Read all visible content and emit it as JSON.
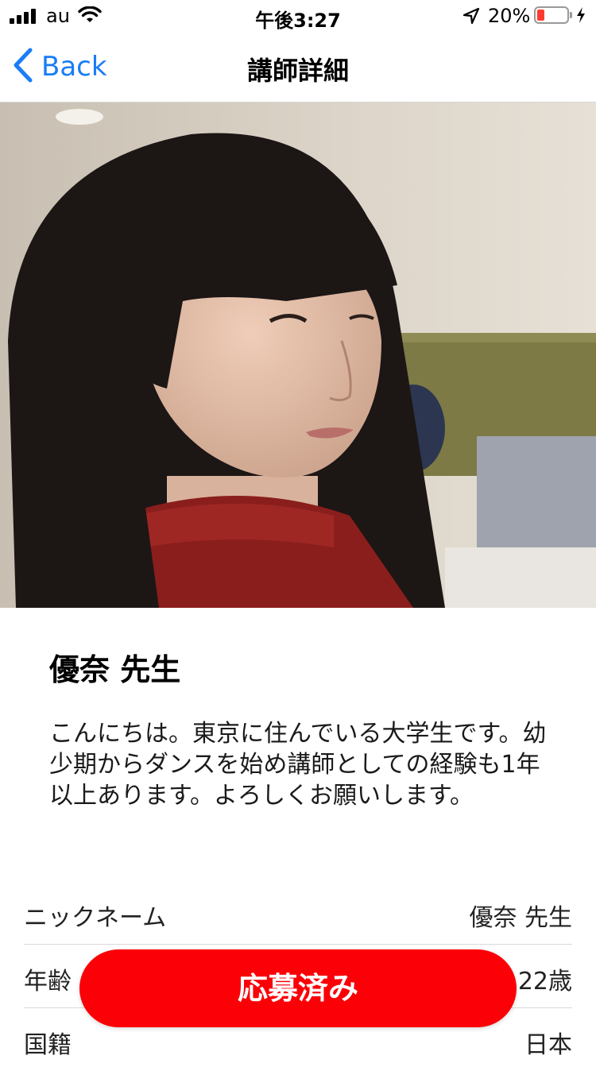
{
  "status_bar": {
    "carrier": "au",
    "time": "午後3:27",
    "battery_percent": "20%",
    "battery_level": 0.2,
    "battery_color": "#ff3b30"
  },
  "nav": {
    "back_label": "Back",
    "title": "講師詳細",
    "accent_color": "#1a7df5"
  },
  "teacher": {
    "photo_icon": "teacher-portrait-photo",
    "name": "優奈 先生",
    "bio": "こんにちは。東京に住んでいる大学生です。幼少期からダンスを始め講師としての経験も1年以上あります。よろしくお願いします。",
    "details": [
      {
        "label": "ニックネーム",
        "value": "優奈 先生"
      },
      {
        "label": "年齢",
        "value": "22歳"
      },
      {
        "label": "国籍",
        "value": "日本"
      }
    ]
  },
  "apply_button": {
    "label": "応募済み",
    "color": "#fb0007"
  }
}
